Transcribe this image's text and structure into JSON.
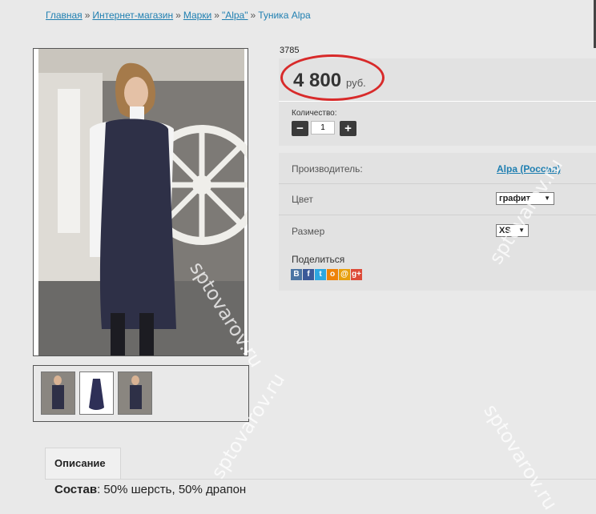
{
  "breadcrumb": {
    "items": [
      "Главная",
      "Интернет-магазин",
      "Марки",
      "\"Alpa\""
    ],
    "separator": "»",
    "current": "Туника Alpa"
  },
  "product": {
    "sku": "3785",
    "price": "4 800",
    "currency": "руб.",
    "quantity_label": "Количество:",
    "quantity_value": "1",
    "minus": "−",
    "plus": "+"
  },
  "properties": {
    "manufacturer_label": "Производитель:",
    "manufacturer_value": "Alpa (Россия)",
    "color_label": "Цвет",
    "color_value": "графит",
    "size_label": "Размер",
    "size_value": "XS"
  },
  "share": {
    "label": "Поделиться",
    "icons": [
      {
        "name": "vk-icon",
        "glyph": "B",
        "color": "#4c75a3"
      },
      {
        "name": "facebook-icon",
        "glyph": "f",
        "color": "#3b5998"
      },
      {
        "name": "twitter-icon",
        "glyph": "t",
        "color": "#2ea7e0"
      },
      {
        "name": "odnoklassniki-icon",
        "glyph": "o",
        "color": "#ee8208"
      },
      {
        "name": "mailru-icon",
        "glyph": "@",
        "color": "#e8a00d"
      },
      {
        "name": "googleplus-icon",
        "glyph": "g+",
        "color": "#dd4b39"
      }
    ]
  },
  "description": {
    "tab_label": "Описание",
    "composition_label": "Состав",
    "composition_value": ": 50% шерсть, 50% драпон"
  },
  "watermark": "sptovarov.ru",
  "colors": {
    "link": "#1f7fb1",
    "price_circle": "#d82a2a",
    "background": "#e9e9e9"
  }
}
